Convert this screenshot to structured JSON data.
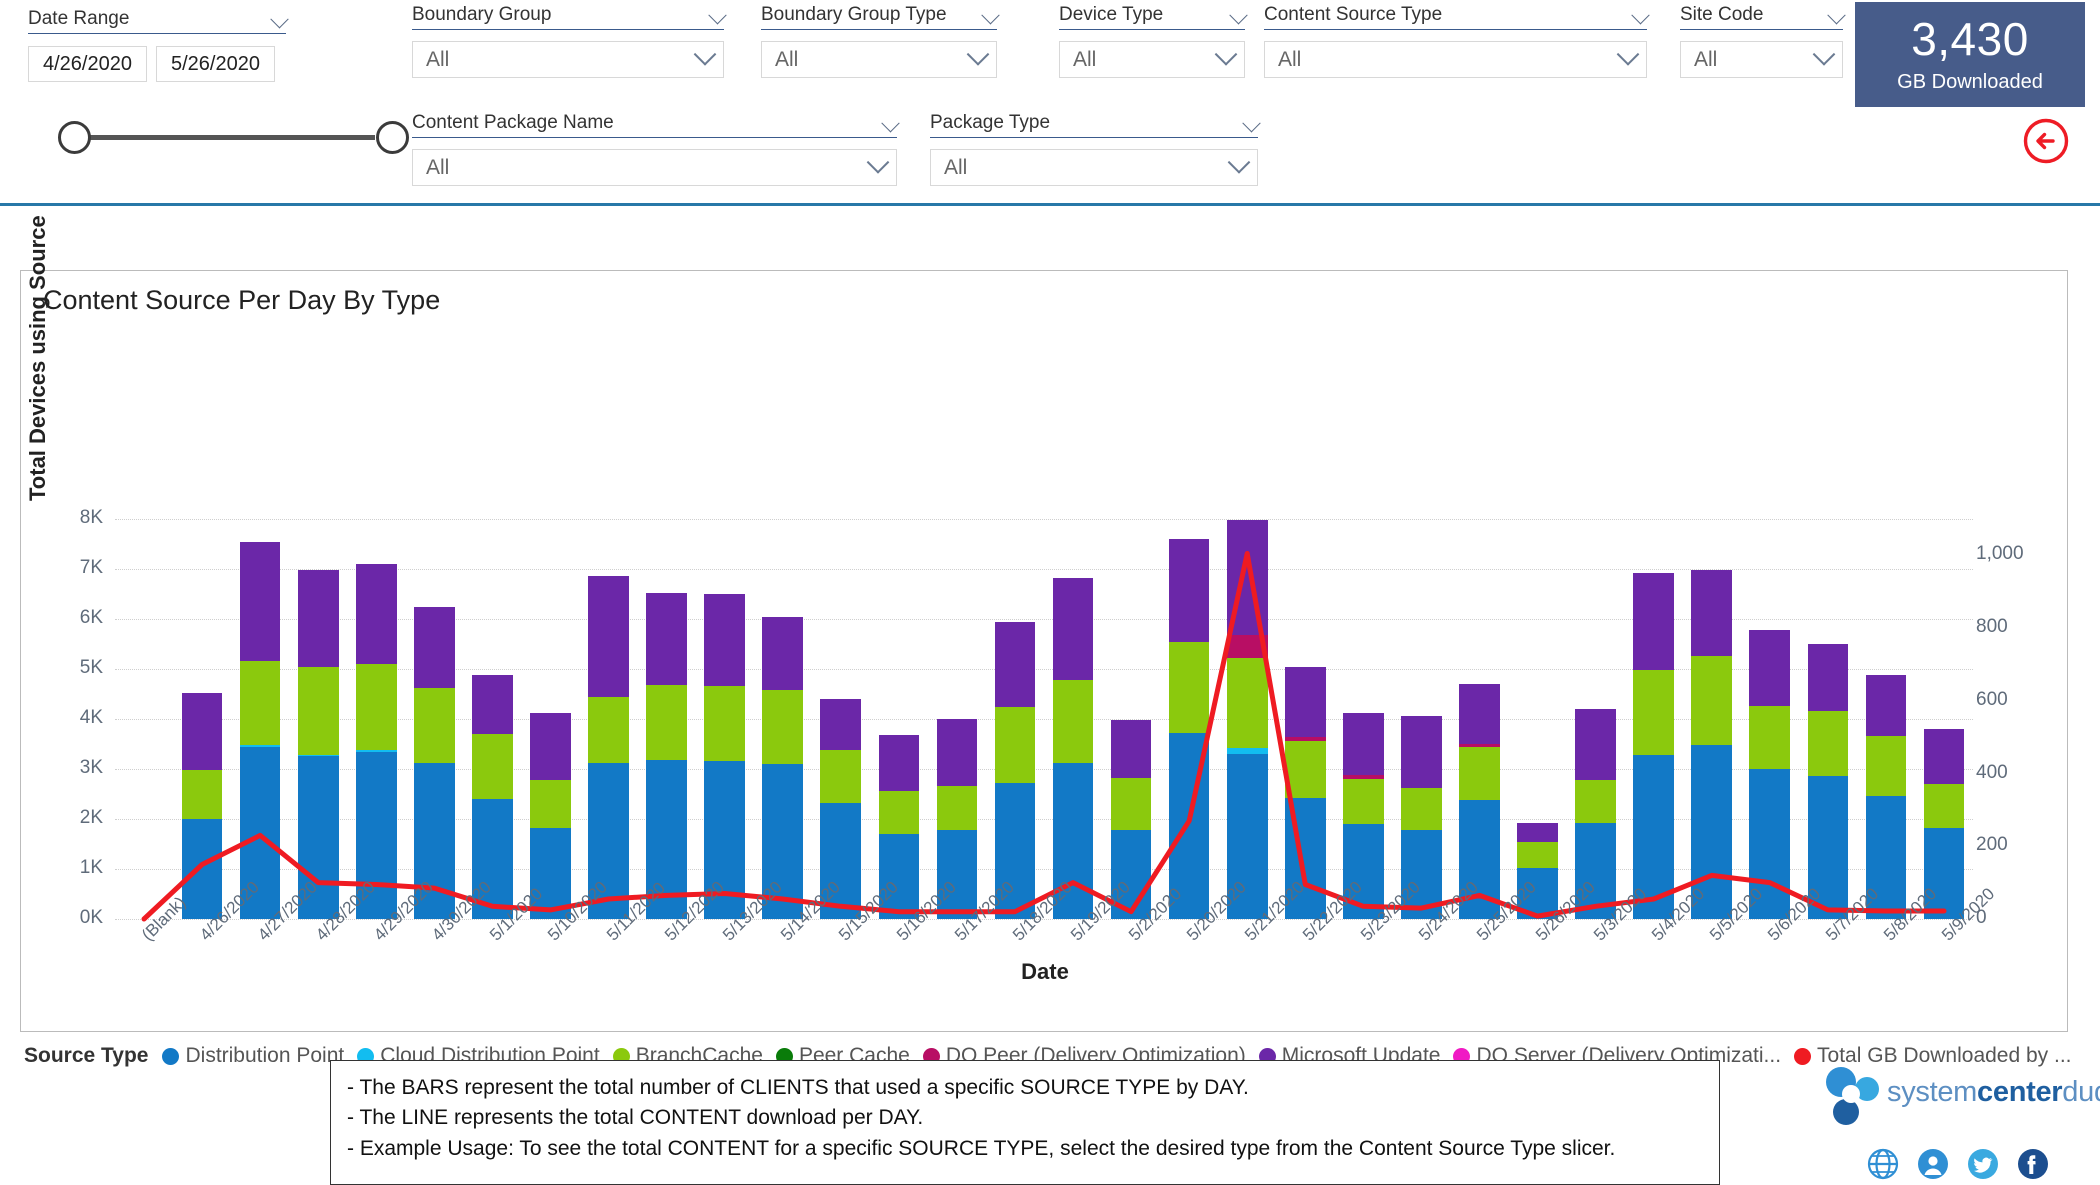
{
  "filters": {
    "date_range": {
      "title": "Date Range",
      "start": "4/26/2020",
      "end": "5/26/2020"
    },
    "slicers": [
      {
        "title": "Boundary Group",
        "value": "All"
      },
      {
        "title": "Boundary Group Type",
        "value": "All"
      },
      {
        "title": "Device Type",
        "value": "All"
      },
      {
        "title": "Content Source Type",
        "value": "All"
      },
      {
        "title": "Site Code",
        "value": "All"
      },
      {
        "title": "Content Package Name",
        "value": "All"
      },
      {
        "title": "Package Type",
        "value": "All"
      }
    ]
  },
  "kpi": {
    "value": "3,430",
    "label": "GB Downloaded",
    "background": "#475c8a"
  },
  "back_button": {
    "name": "back-arrow",
    "color": "#ee1c25"
  },
  "legend": {
    "title": "Source Type",
    "items": [
      {
        "label": "Distribution Point",
        "color": "#1279c6"
      },
      {
        "label": "Cloud Distribution Point",
        "color": "#12bdf0"
      },
      {
        "label": "BranchCache",
        "color": "#8bc90d"
      },
      {
        "label": "Peer Cache",
        "color": "#0a7c0a"
      },
      {
        "label": "DO Peer (Delivery Optimization)",
        "color": "#b80e64"
      },
      {
        "label": "Microsoft Update",
        "color": "#6b27a8"
      },
      {
        "label": "DO Server (Delivery Optimizati...",
        "color": "#f01ac4"
      },
      {
        "label": "Total GB Downloaded by ...",
        "color": "#ef1b22"
      }
    ]
  },
  "footnote": {
    "lines": [
      "- The BARS represent the total number of CLIENTS that used a specific SOURCE TYPE by DAY.",
      "- The LINE represents the total CONTENT download per DAY.",
      "- Example Usage: To see the total CONTENT for a specific SOURCE TYPE, select the desired type from the Content Source Type slicer."
    ]
  },
  "branding": {
    "logo_light_1": "system",
    "logo_bold": "center",
    "logo_light_2": "dudes",
    "social": [
      {
        "name": "globe-icon",
        "color": "#2f8fd4"
      },
      {
        "name": "support-icon",
        "color": "#2f8fd4"
      },
      {
        "name": "twitter-icon",
        "color": "#3aa9e0"
      },
      {
        "name": "facebook-icon",
        "color": "#1c4e8f"
      }
    ]
  },
  "chart_data": {
    "type": "bar",
    "title": "Content Source Per Day By Type",
    "xlabel": "Date",
    "ylabel": "Total Devices using Source",
    "y2label": "",
    "ylim": [
      0,
      8000
    ],
    "y2lim": [
      0,
      1100
    ],
    "yticks": [
      "0K",
      "1K",
      "2K",
      "3K",
      "4K",
      "5K",
      "6K",
      "7K",
      "8K"
    ],
    "ytick_values": [
      0,
      1000,
      2000,
      3000,
      4000,
      5000,
      6000,
      7000,
      8000
    ],
    "y2ticks": [
      "0",
      "200",
      "400",
      "600",
      "800",
      "1,000"
    ],
    "y2tick_values": [
      0,
      200,
      400,
      600,
      800,
      1000
    ],
    "grid": true,
    "legend_position": "bottom",
    "categories": [
      "(Blank)",
      "4/26/2020",
      "4/27/2020",
      "4/28/2020",
      "4/29/2020",
      "4/30/2020",
      "5/1/2020",
      "5/10/2020",
      "5/11/2020",
      "5/12/2020",
      "5/13/2020",
      "5/14/2020",
      "5/15/2020",
      "5/16/2020",
      "5/17/2020",
      "5/18/2020",
      "5/19/2020",
      "5/2/2020",
      "5/20/2020",
      "5/21/2020",
      "5/22/2020",
      "5/23/2020",
      "5/24/2020",
      "5/25/2020",
      "5/26/2020",
      "5/3/2020",
      "5/4/2020",
      "5/5/2020",
      "5/6/2020",
      "5/7/2020",
      "5/8/2020",
      "5/9/2020"
    ],
    "series": [
      {
        "name": "Distribution Point",
        "color": "#1279c6",
        "values": [
          0,
          2000,
          3450,
          3270,
          3350,
          3130,
          2400,
          1830,
          3130,
          3180,
          3170,
          3110,
          2320,
          1700,
          1780,
          2720,
          3130,
          1780,
          3720,
          3300,
          2430,
          1900,
          1790,
          2390,
          1020,
          1920,
          3290,
          3480,
          3000,
          2870,
          2470,
          1830
        ]
      },
      {
        "name": "Cloud Distribution Point",
        "color": "#12bdf0",
        "values": [
          0,
          0,
          30,
          20,
          40,
          0,
          0,
          0,
          0,
          0,
          0,
          0,
          0,
          0,
          0,
          0,
          0,
          0,
          0,
          130,
          0,
          0,
          0,
          0,
          0,
          0,
          0,
          0,
          0,
          0,
          0,
          0
        ]
      },
      {
        "name": "BranchCache",
        "color": "#8bc90d",
        "values": [
          0,
          980,
          1680,
          1760,
          1710,
          1500,
          1300,
          950,
          1320,
          1510,
          1500,
          1480,
          1060,
          870,
          880,
          1530,
          1650,
          1040,
          1820,
          1790,
          1140,
          900,
          840,
          1060,
          530,
          870,
          1700,
          1790,
          1270,
          1300,
          1190,
          870
        ]
      },
      {
        "name": "Peer Cache",
        "color": "#0a7c0a",
        "values": [
          0,
          0,
          0,
          0,
          0,
          0,
          0,
          0,
          0,
          0,
          0,
          0,
          0,
          0,
          0,
          0,
          0,
          0,
          0,
          0,
          0,
          0,
          0,
          0,
          0,
          0,
          0,
          0,
          0,
          0,
          0,
          0
        ]
      },
      {
        "name": "DO Peer (Delivery Optimization)",
        "color": "#b80e64",
        "values": [
          0,
          0,
          0,
          0,
          0,
          0,
          0,
          0,
          0,
          0,
          0,
          0,
          0,
          0,
          0,
          0,
          0,
          0,
          0,
          470,
          80,
          80,
          0,
          60,
          0,
          0,
          0,
          0,
          0,
          0,
          0,
          0
        ]
      },
      {
        "name": "Microsoft Update",
        "color": "#6b27a8",
        "values": [
          0,
          1540,
          2380,
          1930,
          2010,
          1610,
          1180,
          1350,
          2420,
          1830,
          1830,
          1460,
          1020,
          1110,
          1340,
          1690,
          2040,
          1170,
          2060,
          2290,
          1400,
          1250,
          1440,
          1190,
          370,
          1410,
          1930,
          1720,
          1520,
          1330,
          1220,
          1110
        ]
      },
      {
        "name": "DO Server (Delivery Optimizati...",
        "color": "#f01ac4",
        "values": [
          0,
          0,
          0,
          0,
          0,
          0,
          0,
          0,
          0,
          0,
          0,
          0,
          0,
          0,
          0,
          0,
          0,
          0,
          0,
          0,
          0,
          0,
          0,
          0,
          0,
          0,
          0,
          0,
          0,
          0,
          0,
          0
        ]
      }
    ],
    "line_series": {
      "name": "Total GB Downloaded by ...",
      "color": "#ef1b22",
      "axis": "secondary",
      "values": [
        0,
        150,
        230,
        100,
        95,
        85,
        35,
        25,
        55,
        65,
        70,
        55,
        35,
        20,
        20,
        20,
        100,
        20,
        270,
        1005,
        95,
        35,
        30,
        65,
        8,
        35,
        55,
        120,
        100,
        25,
        22,
        22
      ]
    }
  }
}
